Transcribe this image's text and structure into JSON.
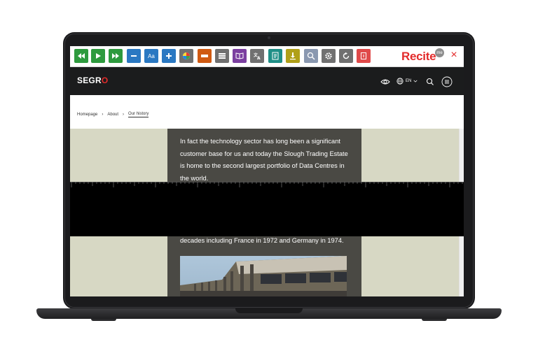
{
  "toolbar": {
    "brand": "Recite",
    "brand_badge": "me",
    "text_size_label": "Aa",
    "colors": {
      "green": "#2e9a3e",
      "blue": "#2a78c2",
      "orange": "#d05a12",
      "gray": "#707070",
      "purple": "#7b3fa0",
      "teal": "#1f8f87",
      "olive": "#b0a019",
      "steel": "#8a98b0",
      "red": "#e04a4a"
    }
  },
  "site": {
    "logo_text": "SEGR",
    "logo_accent": "O",
    "language": "EN"
  },
  "breadcrumb": {
    "home": "Homepage",
    "about": "About",
    "current": "Our history"
  },
  "article": {
    "paragraph": "In fact the technology sector has long been a significant customer base for us and today the Slough Trading Estate is home to the second largest portfolio of Data Centres in the world.",
    "paragraph_continued": "decades including France in 1972 and Germany in 1974."
  }
}
